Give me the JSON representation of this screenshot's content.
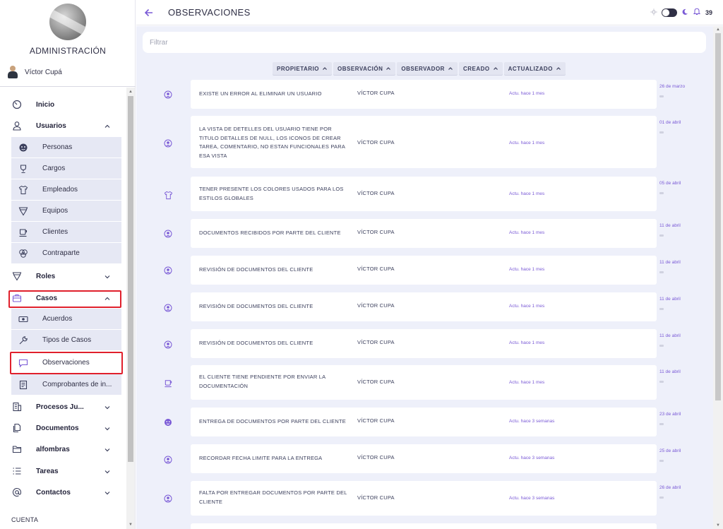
{
  "sidebar": {
    "title": "ADMINISTRACIÓN",
    "user_name": "Víctor Cupá",
    "footer": "CUENTA",
    "items": [
      {
        "label": "Inicio",
        "icon": "clock-icon"
      },
      {
        "label": "Usuarios",
        "icon": "user-icon",
        "expanded": true
      },
      {
        "label": "Personas",
        "icon": "face-icon"
      },
      {
        "label": "Cargos",
        "icon": "trophy-icon"
      },
      {
        "label": "Empleados",
        "icon": "shirt-icon"
      },
      {
        "label": "Equipos",
        "icon": "shield-icon"
      },
      {
        "label": "Clientes",
        "icon": "cup-icon"
      },
      {
        "label": "Contraparte",
        "icon": "circles-icon"
      },
      {
        "label": "Roles",
        "icon": "badge-icon"
      },
      {
        "label": "Casos",
        "icon": "briefcase-icon",
        "expanded": true
      },
      {
        "label": "Acuerdos",
        "icon": "money-icon"
      },
      {
        "label": "Tipos de Casos",
        "icon": "wrench-icon"
      },
      {
        "label": "Observaciones",
        "icon": "comment-icon"
      },
      {
        "label": "Comprobantes de in...",
        "icon": "receipt-icon"
      },
      {
        "label": "Procesos Ju...",
        "icon": "building-icon"
      },
      {
        "label": "Documentos",
        "icon": "documents-icon"
      },
      {
        "label": "alfombras",
        "icon": "folder-icon"
      },
      {
        "label": "Tareas",
        "icon": "list-icon"
      },
      {
        "label": "Contactos",
        "icon": "at-icon"
      }
    ]
  },
  "header": {
    "title": "OBSERVACIONES",
    "notification_count": "39"
  },
  "filter": {
    "placeholder": "Filtrar"
  },
  "sort_buttons": [
    "PROPIETARIO",
    "OBSERVACIÓN",
    "OBSERVADOR",
    "CREADO",
    "ACTUALIZADO"
  ],
  "rows": [
    {
      "icon": "person-icon",
      "text": "EXISTE UN ERROR AL ELIMINAR UN USUARIO",
      "observer": "VÍCTOR CUPA",
      "updated": "Actu. hace 1 mes",
      "date": "26 de marzo"
    },
    {
      "icon": "person-icon",
      "text": "LA VISTA DE DETELLES DEL USUARIO TIENE POR TITULO DETALLES DE NULL, LOS ICONOS DE CREAR TAREA, COMENTARIO, NO ESTAN FUNCIONALES PARA ESA VISTA",
      "observer": "VÍCTOR CUPA",
      "updated": "Actu. hace 1 mes",
      "date": "01 de abril"
    },
    {
      "icon": "shirt-icon",
      "text": "TENER PRESENTE LOS COLORES USADOS PARA LOS ESTILOS GLOBALES",
      "observer": "VÍCTOR CUPA",
      "updated": "Actu. hace 1 mes",
      "date": "05 de abril"
    },
    {
      "icon": "person-icon",
      "text": "DOCUMENTOS RECIBIDOS POR PARTE DEL CLIENTE",
      "observer": "VÍCTOR CUPA",
      "updated": "Actu. hace 1 mes",
      "date": "11 de abril"
    },
    {
      "icon": "person-icon",
      "text": "REVISIÓN DE DOCUMENTOS DEL CLIENTE",
      "observer": "VÍCTOR CUPA",
      "updated": "Actu. hace 1 mes",
      "date": "11 de abril"
    },
    {
      "icon": "person-icon",
      "text": "REVISIÓN DE DOCUMENTOS DEL CLIENTE",
      "observer": "VÍCTOR CUPA",
      "updated": "Actu. hace 1 mes",
      "date": "11 de abril"
    },
    {
      "icon": "person-icon",
      "text": "REVISIÓN DE DOCUMENTOS DEL CLIENTE",
      "observer": "VÍCTOR CUPA",
      "updated": "Actu. hace 1 mes",
      "date": "11 de abril"
    },
    {
      "icon": "cup-icon",
      "text": "EL CLIENTE TIENE PENDIENTE POR ENVIAR LA DOCUMENTACIÓN",
      "observer": "VÍCTOR CUPA",
      "updated": "Actu. hace 1 mes",
      "date": "11 de abril"
    },
    {
      "icon": "face-icon",
      "text": "ENTREGA DE DOCUMENTOS POR PARTE DEL CLIENTE",
      "observer": "VÍCTOR CUPA",
      "updated": "Actu. hace 3 semanas",
      "date": "23 de abril"
    },
    {
      "icon": "person-icon",
      "text": "RECORDAR FECHA LIMITE PARA LA ENTREGA",
      "observer": "VÍCTOR CUPA",
      "updated": "Actu. hace 3 semanas",
      "date": "25 de abril"
    },
    {
      "icon": "person-icon",
      "text": "FALTA POR ENTREGAR DOCUMENTOS POR PARTE DEL CLIENTE",
      "observer": "VÍCTOR CUPA",
      "updated": "Actu. hace 3 semanas",
      "date": "26 de abril"
    }
  ],
  "colors": {
    "accent": "#7a5ad6",
    "highlight": "#e0202c",
    "background": "#eef0fa"
  }
}
